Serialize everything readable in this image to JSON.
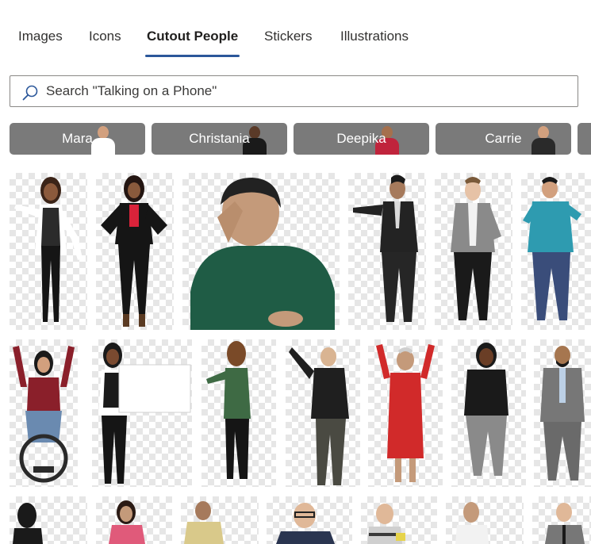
{
  "tabs": [
    {
      "label": "Images",
      "active": false
    },
    {
      "label": "Icons",
      "active": false
    },
    {
      "label": "Cutout People",
      "active": true
    },
    {
      "label": "Stickers",
      "active": false
    },
    {
      "label": "Illustrations",
      "active": false
    }
  ],
  "search": {
    "placeholder": "Search \"Talking on a Phone\"",
    "value": "",
    "icon": "search-icon"
  },
  "chips": [
    "Mara",
    "Christania",
    "Deepika",
    "Carrie",
    ""
  ],
  "colors": {
    "accent": "#2b579a",
    "chip": "#7a7a7a",
    "checker": "#e6e6e6"
  },
  "results": {
    "row1": [
      "person-woman-vest-pointing",
      "person-woman-red-top-hands-on-hips",
      "person-man-green-shirt-thinking",
      "person-man-suit-pointing",
      "person-man-grey-blazer-thinking",
      "person-man-blue-jacket-thumbs-up"
    ],
    "row2": [
      "person-woman-wheelchair-cheering",
      "person-woman-holding-blank-sign",
      "person-woman-green-sweater-pointing",
      "person-man-black-sweater-raising-hand",
      "person-woman-red-dress-cheering",
      "person-woman-black-top-thinking",
      "person-man-grey-suit-thumbs-up"
    ],
    "row3": [
      "person-woman-phone",
      "person-woman-pink-phone",
      "person-man-yellow-shirt",
      "person-man-glasses-suit",
      "person-boy-striped-shirt",
      "person-woman-white-top-thumbs-up",
      "person-man-suit-waving"
    ]
  }
}
